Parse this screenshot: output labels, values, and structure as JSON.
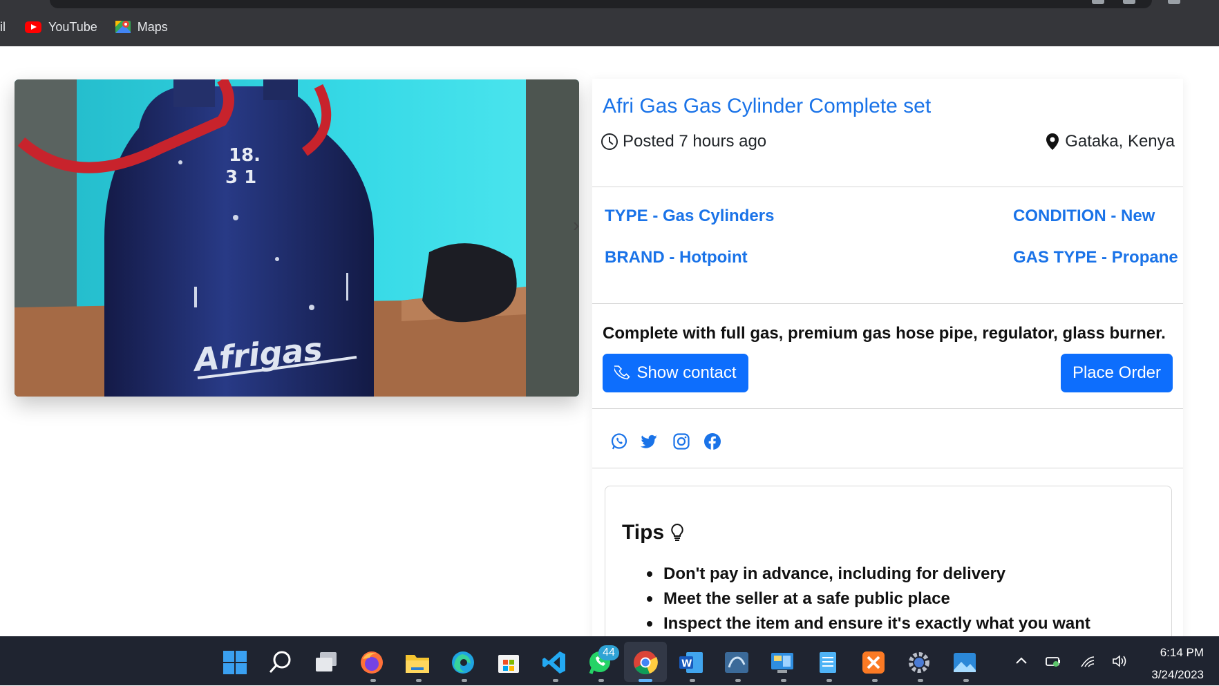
{
  "browser": {
    "bookmarks": [
      {
        "label": "il",
        "icon": "gmail-cut-icon"
      },
      {
        "label": "YouTube",
        "icon": "youtube-icon"
      },
      {
        "label": "Maps",
        "icon": "google-maps-icon"
      }
    ]
  },
  "listing": {
    "photo_label": "18. 3 Afrigas",
    "title": "Afri Gas Gas Cylinder Complete set",
    "posted": "Posted 7 hours ago",
    "location": "Gataka, Kenya",
    "attributes": {
      "type": "TYPE - Gas Cylinders",
      "condition": "CONDITION - New",
      "brand": "BRAND - Hotpoint",
      "gas_type": "GAS TYPE - Propane"
    },
    "description": "Complete with full gas, premium gas hose pipe, regulator, glass burner.",
    "show_contact": "Show contact",
    "place_order": "Place Order",
    "share_icons": [
      "whatsapp-icon",
      "twitter-icon",
      "instagram-icon",
      "facebook-icon"
    ]
  },
  "tips": {
    "title": "Tips",
    "items": [
      "Don't pay in advance, including for delivery",
      "Meet the seller at a safe public place",
      "Inspect the item and ensure it's exactly what you want"
    ]
  },
  "taskbar": {
    "whatsapp_badge": "44",
    "time": "6:14 PM",
    "date": "3/24/2023"
  },
  "colors": {
    "accent": "#1a73e8",
    "button": "#0d6efd",
    "chrome": "#35363a",
    "taskbar": "#1f2430"
  }
}
